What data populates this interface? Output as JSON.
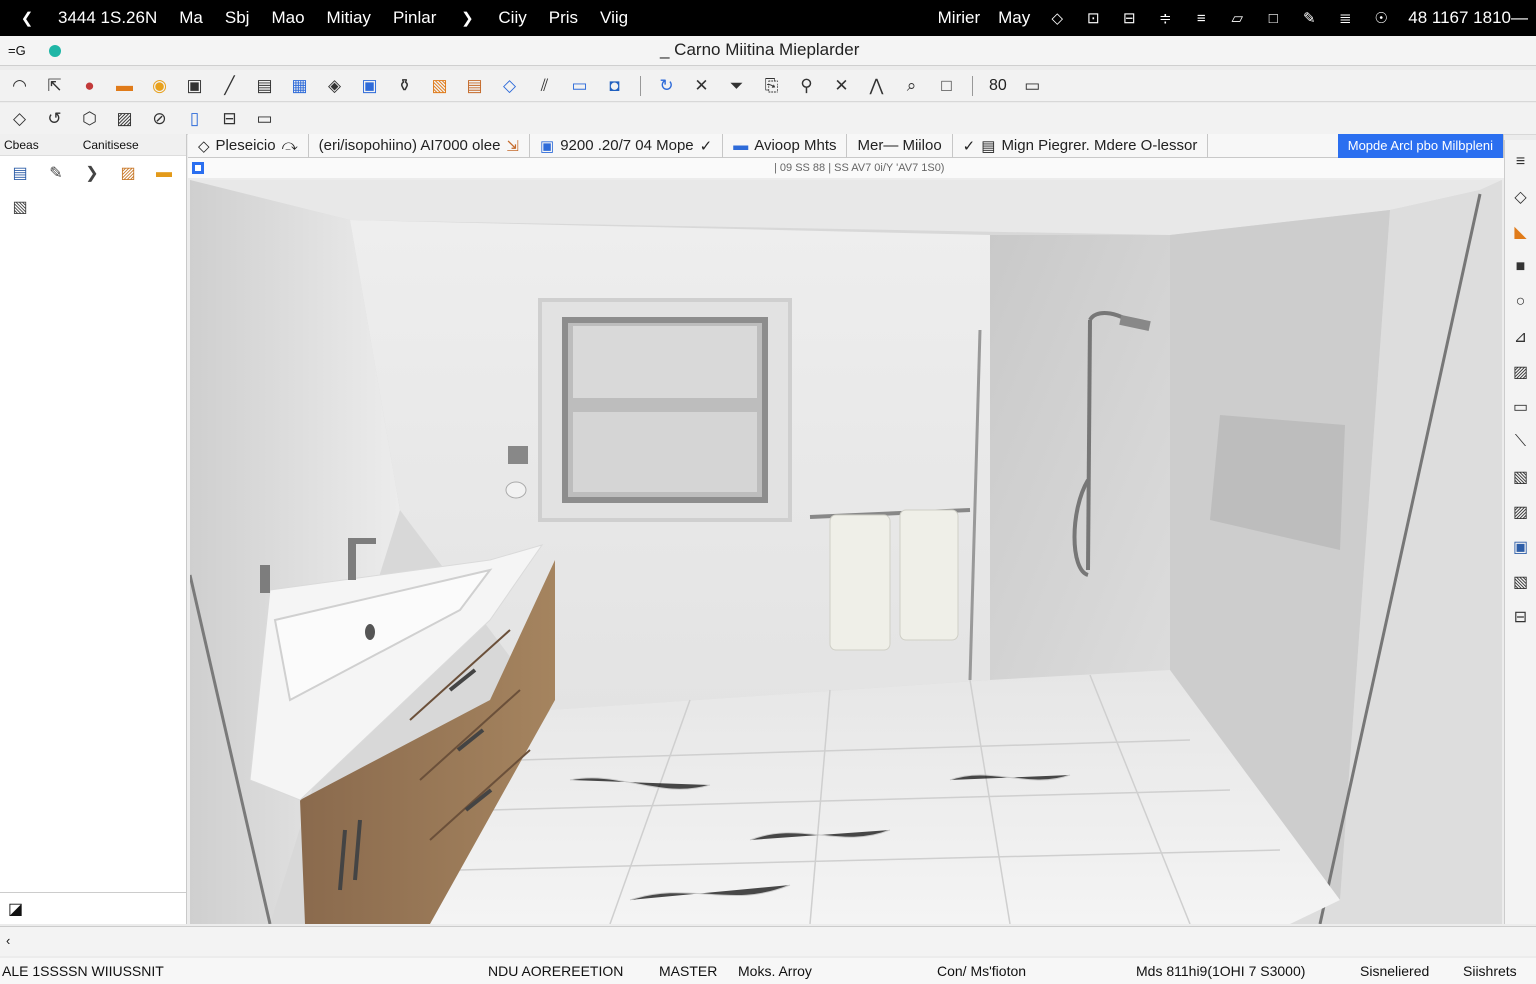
{
  "menubar": {
    "clock": "3444 1S.26N",
    "items": [
      "Ma",
      "Sbj",
      "Mao",
      "Mitiay",
      "Pinlar"
    ],
    "items2": [
      "Ciiy",
      "Pris",
      "Viig"
    ],
    "right_items": [
      "Mirier",
      "May"
    ],
    "status_right": "48 1167 1810—"
  },
  "titlebar": {
    "title": "_ Carno Miitina Mieplarder",
    "left_ctl": "=G"
  },
  "toolbar": {
    "zoom": "80"
  },
  "tabs": [
    {
      "label": "Pleseicio",
      "icon": "pointer-icon"
    },
    {
      "label": "(eri/isopohiino) AI7000 olee",
      "icon": "document-icon"
    },
    {
      "label": "9200 .20/7 04 Mope",
      "icon": "check-icon"
    },
    {
      "label": "Avioop Mhts",
      "icon": "tab-icon"
    },
    {
      "label": "Mer— Miiloo",
      "icon": "check-icon"
    },
    {
      "label": "Mign Piegrer. Mdere O-lessor",
      "icon": "check-icon"
    },
    {
      "label": "Mopde Arcl pbo Milbpleni",
      "icon": "tab-icon"
    }
  ],
  "subheader": {
    "text": "| 09 SS 88 | SS AV7 0i/Y 'AV7 1S0)"
  },
  "leftpanel": {
    "col1": "Cbeas",
    "col2": "Canitisese"
  },
  "statusbar": {
    "left": "ALE 1SSSSN WIIUSSNIT",
    "mode": "NDU AOREREETION",
    "layer": "MASTER",
    "material": "Moks. Arroy",
    "coord_label": "Con/ Ms'fioton",
    "coords": "Mds 811hi9(1OHI 7 S3000)",
    "sel": "Sisneliered",
    "sel2": "Siishrets"
  },
  "colors": {
    "accent": "#2b6ff0",
    "menubar_bg": "#000000"
  }
}
